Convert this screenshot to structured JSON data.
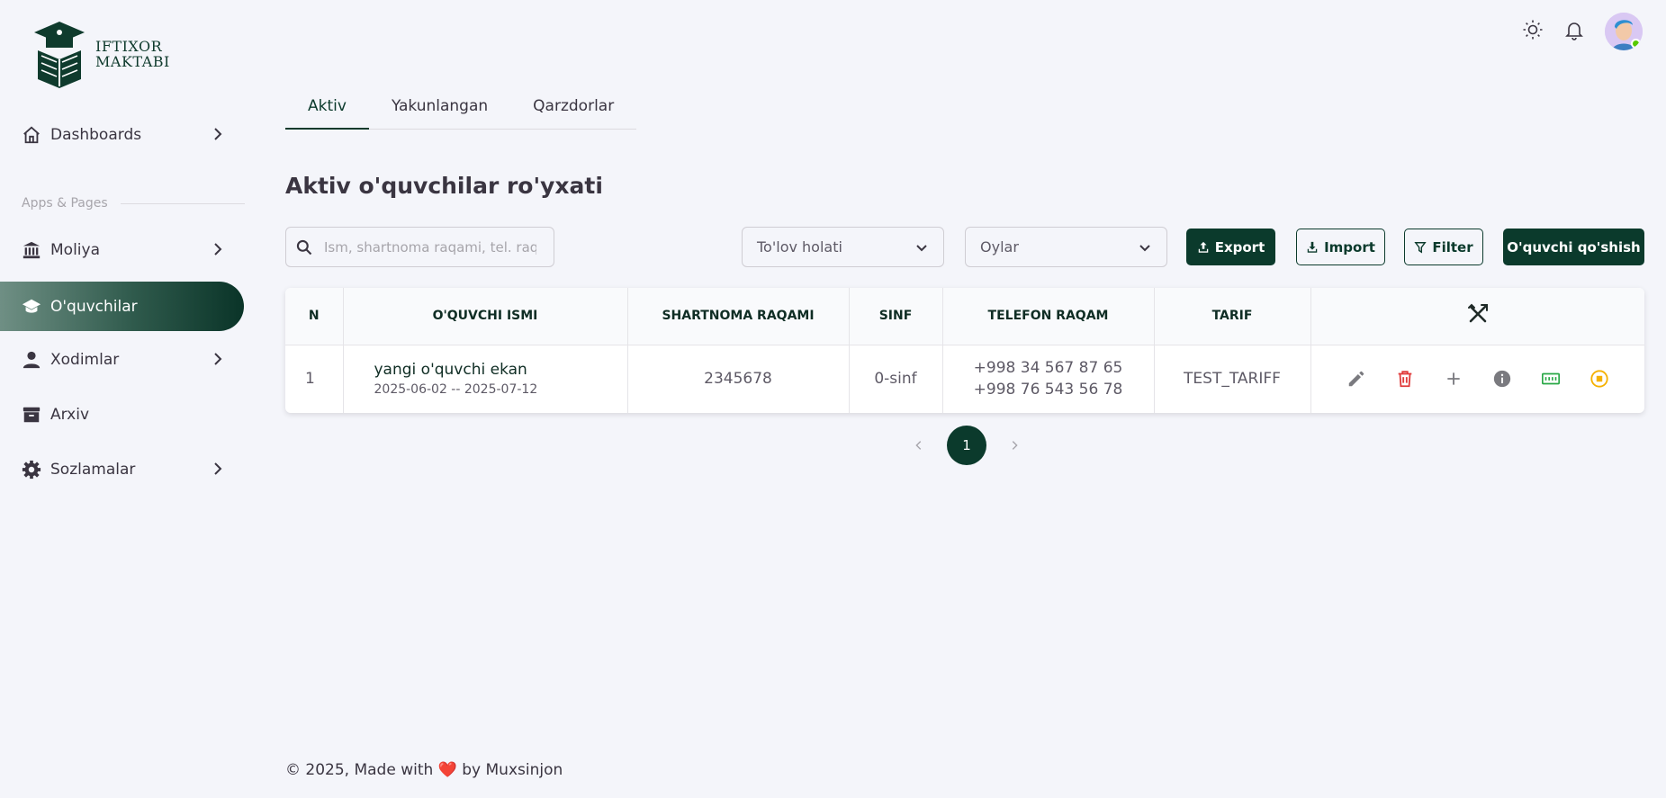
{
  "brand": {
    "line1": "IFTIXOR",
    "line2": "MAKTABI"
  },
  "sidebar": {
    "section_label": "Apps & Pages",
    "items": [
      {
        "label": "Dashboards"
      },
      {
        "label": "Moliya"
      },
      {
        "label": "O'quvchilar"
      },
      {
        "label": "Xodimlar"
      },
      {
        "label": "Arxiv"
      },
      {
        "label": "Sozlamalar"
      }
    ]
  },
  "tabs": [
    {
      "label": "Aktiv"
    },
    {
      "label": "Yakunlangan"
    },
    {
      "label": "Qarzdorlar"
    }
  ],
  "page_title": "Aktiv o'quvchilar ro'yxati",
  "search": {
    "placeholder": "Ism, shartnoma raqami, tel. raqam",
    "value": ""
  },
  "filters": {
    "payment_status": "To'lov holati",
    "months": "Oylar"
  },
  "buttons": {
    "export": "Export",
    "import": "Import",
    "filter": "Filter",
    "add_student": "O'quvchi qo'shish"
  },
  "table": {
    "headers": {
      "n": "N",
      "name": "O'QUVCHI ISMI",
      "contract": "SHARTNOMA RAQAMI",
      "class": "SINF",
      "phone": "TELEFON RAQAM",
      "tariff": "TARIF"
    },
    "rows": [
      {
        "n": "1",
        "name": "yangi o'quvchi ekan",
        "dates": "2025-06-02 -- 2025-07-12",
        "contract": "2345678",
        "class": "0-sinf",
        "phone1": "+998 34 567 87 65",
        "phone2": "+998 76 543 56 78",
        "tariff": "TEST_TARIFF"
      }
    ]
  },
  "pagination": {
    "current": "1"
  },
  "footer": {
    "text": "© 2025, Made with ❤️ by Muxsinjon"
  },
  "colors": {
    "primary": "#0b3a2c",
    "delete": "#e03b3b",
    "info": "#8a8d93",
    "success": "#28a745",
    "warning": "#f5b100"
  }
}
